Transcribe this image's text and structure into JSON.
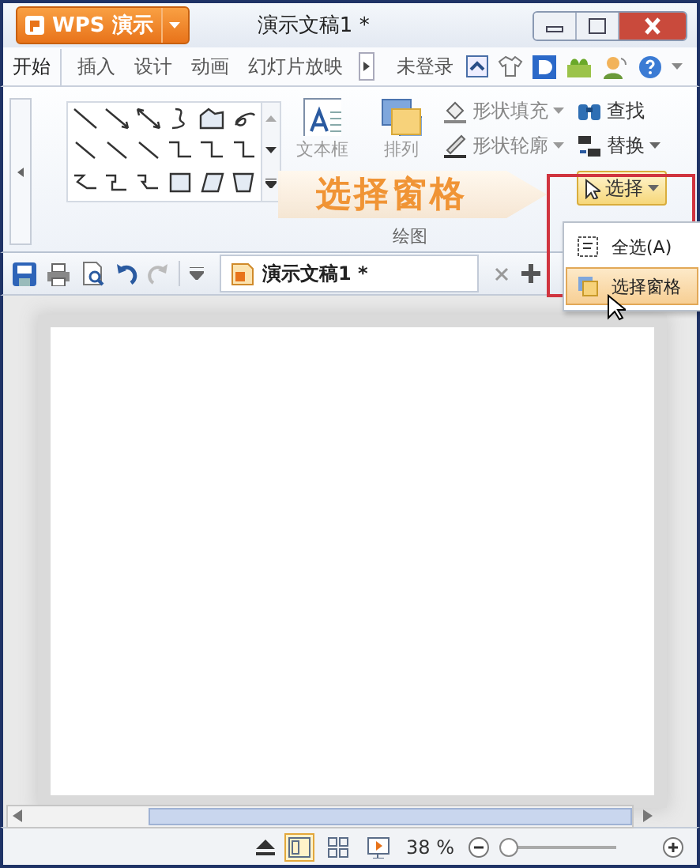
{
  "window": {
    "app_button": "WPS 演示",
    "title": "演示文稿1 *"
  },
  "menu_tabs": [
    {
      "label": "开始",
      "selected": true
    },
    {
      "label": "插入",
      "selected": false
    },
    {
      "label": "设计",
      "selected": false
    },
    {
      "label": "动画",
      "selected": false
    },
    {
      "label": "幻灯片放映",
      "selected": false
    }
  ],
  "account": "未登录",
  "ribbon": {
    "text_box": "文本框",
    "arrange": "排列",
    "shape_fill": "形状填充",
    "shape_outline": "形状轮廓",
    "find": "查找",
    "replace": "替换",
    "select": "选择",
    "group_label": "绘图"
  },
  "callout": "选择窗格",
  "select_menu": [
    {
      "label": "全选(A)",
      "selected": false
    },
    {
      "label": "选择窗格",
      "selected": true
    }
  ],
  "doc_tabs": [
    {
      "label": "演示文稿1 *",
      "selected": true
    }
  ],
  "status_bar": {
    "views": [
      {
        "kind": "normal",
        "selected": true
      },
      {
        "kind": "sorter",
        "selected": false
      },
      {
        "kind": "show",
        "selected": false
      }
    ],
    "zoom": "38 %",
    "zoom_slider": {
      "level": 0.04
    }
  }
}
